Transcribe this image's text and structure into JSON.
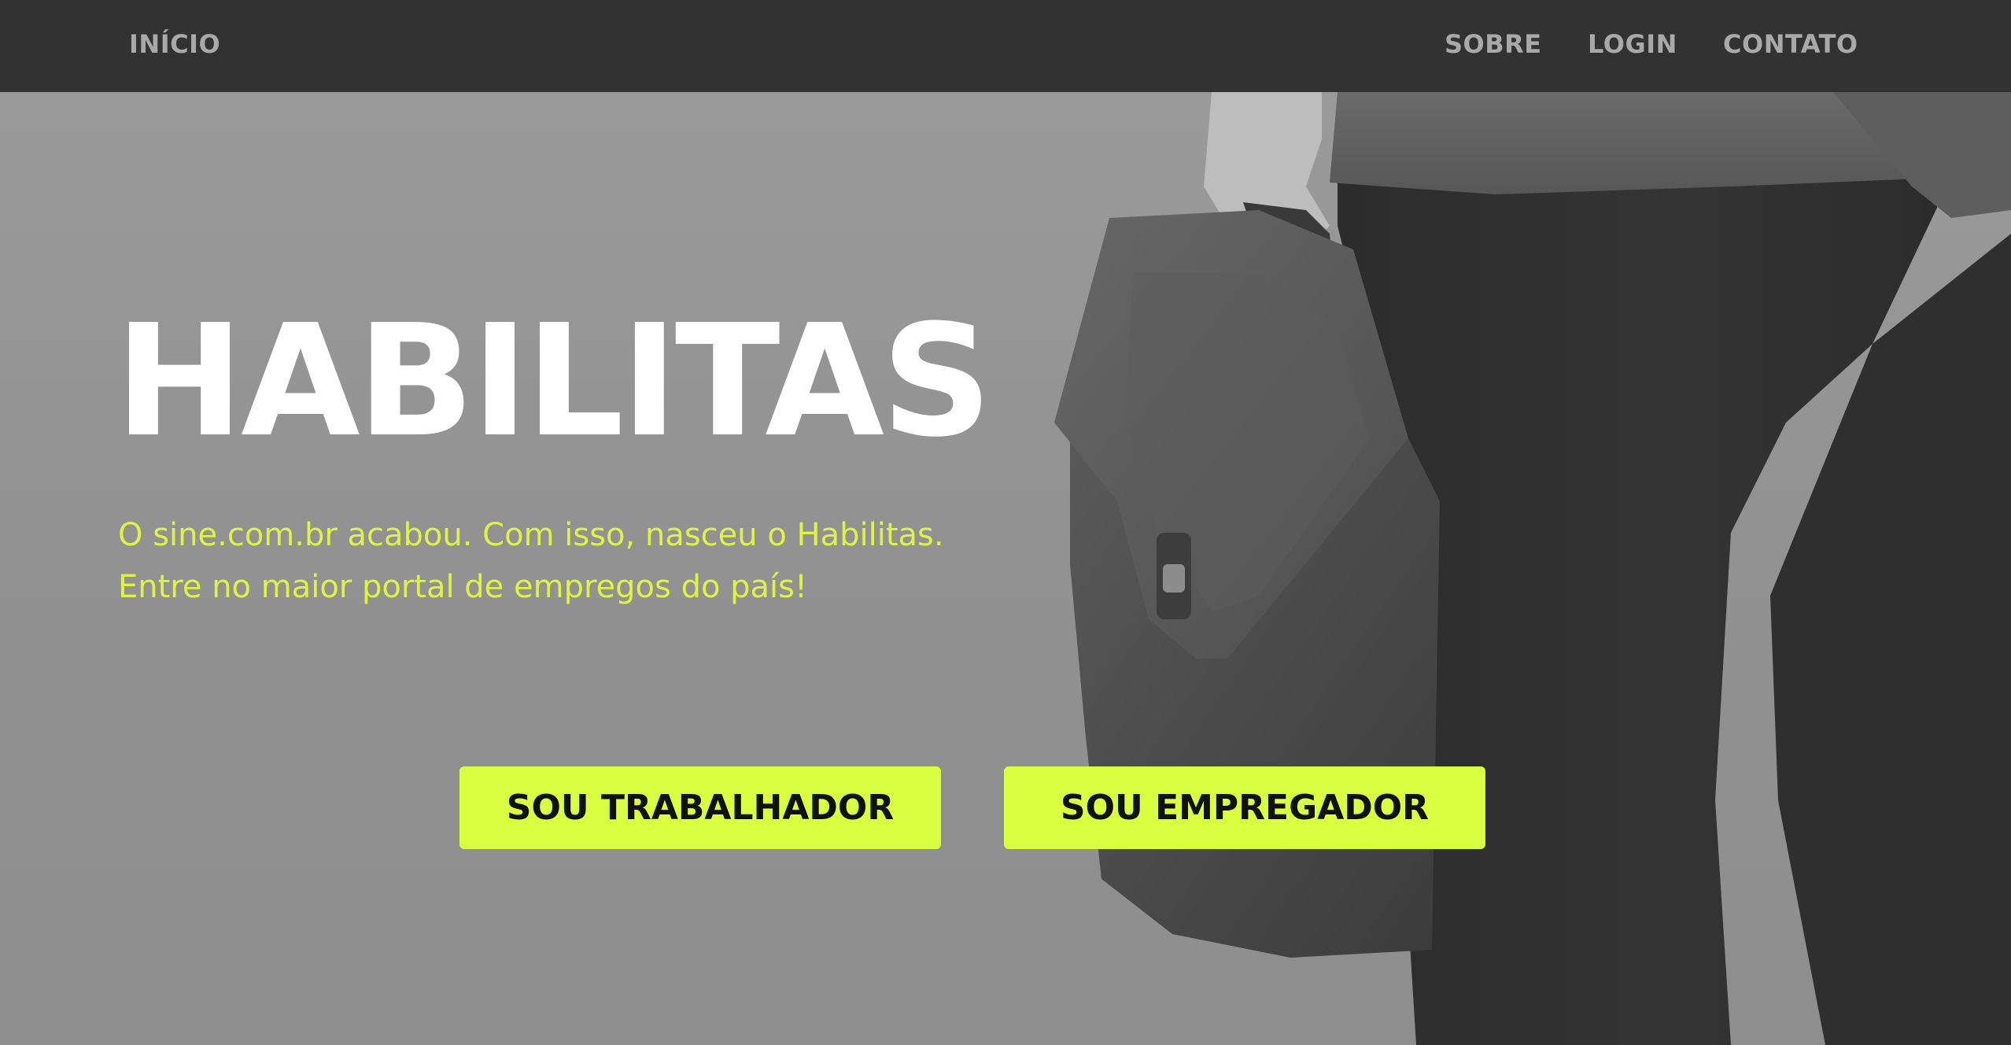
{
  "nav": {
    "home": "INÍCIO",
    "about": "SOBRE",
    "login": "LOGIN",
    "contact": "CONTATO"
  },
  "hero": {
    "title": "HABILITAS",
    "subtitle_line1": "O sine.com.br acabou. Com isso, nasceu o Habilitas.",
    "subtitle_line2": "Entre no maior portal de empregos do país!",
    "buttons": {
      "worker": "SOU TRABALHADOR",
      "employer": "SOU EMPREGADOR"
    }
  },
  "colors": {
    "navbar_bg": "#323232",
    "nav_text": "#a9a9a9",
    "accent": "#d9ff40",
    "subtitle_text": "#dcf542",
    "title_text": "#ffffff"
  },
  "icons": {
    "background_image": "person-carrying-briefcase-photo"
  }
}
